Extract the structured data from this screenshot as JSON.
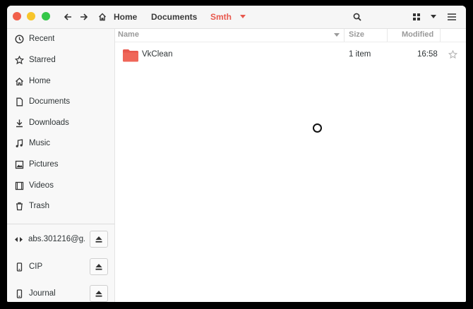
{
  "header": {
    "breadcrumbs": [
      "Home",
      "Documents",
      "Smth"
    ],
    "accent": "#e8584d"
  },
  "sidebar": {
    "places": [
      {
        "label": "Recent",
        "icon": "clock-icon"
      },
      {
        "label": "Starred",
        "icon": "star-icon"
      },
      {
        "label": "Home",
        "icon": "home-icon"
      },
      {
        "label": "Documents",
        "icon": "document-icon"
      },
      {
        "label": "Downloads",
        "icon": "download-icon"
      },
      {
        "label": "Music",
        "icon": "music-icon"
      },
      {
        "label": "Pictures",
        "icon": "picture-icon"
      },
      {
        "label": "Videos",
        "icon": "video-icon"
      },
      {
        "label": "Trash",
        "icon": "trash-icon"
      }
    ],
    "devices": [
      {
        "label": "abs.301216@g...",
        "icon": "network-drive-icon"
      },
      {
        "label": "CIP",
        "icon": "phone-icon"
      },
      {
        "label": "Journal",
        "icon": "phone-icon"
      }
    ]
  },
  "columns": {
    "name": "Name",
    "size": "Size",
    "modified": "Modified"
  },
  "files": [
    {
      "name": "VkClean",
      "size": "1 item",
      "modified": "16:58",
      "icon": "folder-icon",
      "folder_color": "#e8584d"
    }
  ]
}
